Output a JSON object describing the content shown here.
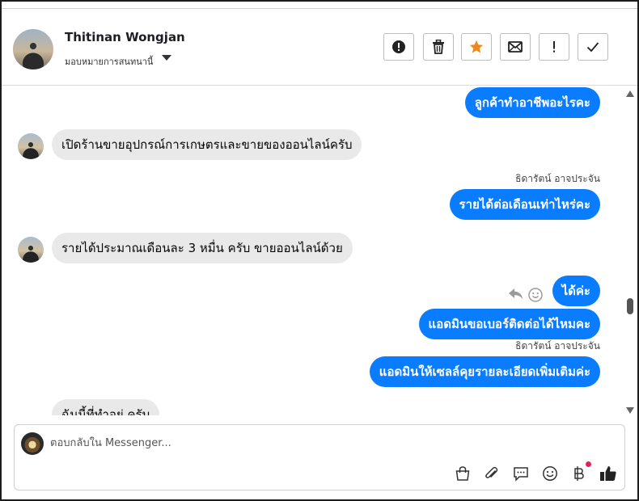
{
  "header": {
    "contact_name": "Thitinan Wongjan",
    "assign_label": "มอบหมายการสนทนานี้",
    "actions": [
      {
        "name": "report-spam",
        "icon": "exclamation-circle-icon"
      },
      {
        "name": "delete",
        "icon": "trash-icon"
      },
      {
        "name": "star",
        "icon": "star-icon"
      },
      {
        "name": "mark-unread",
        "icon": "envelope-icon"
      },
      {
        "name": "follow-up",
        "icon": "exclamation-icon"
      },
      {
        "name": "mark-done",
        "icon": "checkmark-icon"
      }
    ],
    "star_color": "#f0891a"
  },
  "messages": [
    {
      "direction": "out",
      "text": "ลูกค้าทำอาชีพอะไรคะ"
    },
    {
      "direction": "in",
      "text": "เปิดร้านขายอุปกรณ์การเกษตรและขายของออนไลน์ครับ"
    },
    {
      "direction": "out",
      "sender": "ธิดารัตน์ อาจประจัน",
      "text": "รายได้ต่อเดือนเท่าไหร่คะ"
    },
    {
      "direction": "in",
      "text": "รายได้ประมาณเดือนละ 3 หมื่น ครับ ขายออนไลน์ด้วย"
    },
    {
      "direction": "out",
      "text": "ได้ค่ะ"
    },
    {
      "direction": "out",
      "text": "แอดมินขอเบอร์ติดต่อได้ไหมคะ"
    },
    {
      "direction": "out",
      "sender": "ธิดารัตน์ อาจประจัน",
      "text": "แอดมินให้เซลล์คุยรายละเอียดเพิ่มเติมค่ะ"
    },
    {
      "direction": "in",
      "text": "ฉันนี้ที่ทำอยู่ ครับ"
    }
  ],
  "composer": {
    "placeholder": "ตอบกลับใน Messenger...",
    "tools": [
      "shopping-bag-icon",
      "paperclip-icon",
      "chat-bubble-icon",
      "smiley-icon",
      "baht-icon",
      "thumbs-up-icon"
    ]
  },
  "colors": {
    "outgoing_bubble": "#0a7cff",
    "incoming_bubble": "#e9e9ea",
    "notification_dot": "#e0245e"
  }
}
